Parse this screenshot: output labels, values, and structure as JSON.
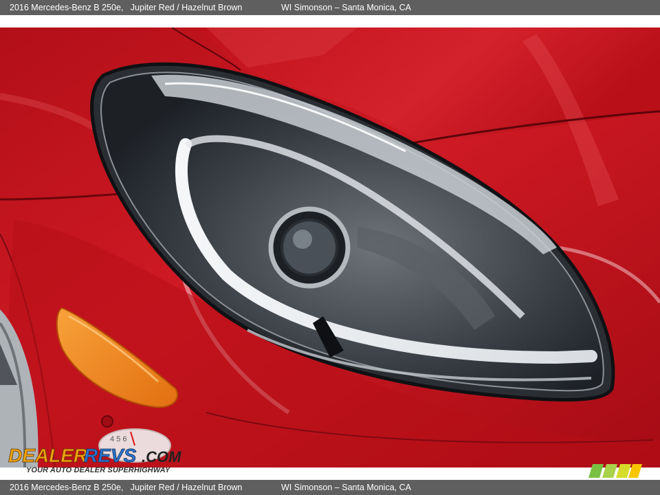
{
  "header": {
    "vehicle": "2016 Mercedes-Benz B 250e,   Jupiter Red / Hazelnut Brown",
    "dealer": "WI Simonson – Santa Monica, CA"
  },
  "footer": {
    "vehicle": "2016 Mercedes-Benz B 250e,   Jupiter Red / Hazelnut Brown",
    "dealer": "WI Simonson – Santa Monica, CA"
  },
  "photo": {
    "subject": "headlight-closeup",
    "paint_color": "#c8141f"
  },
  "watermark": {
    "brand": "DealerRevs.com",
    "tagline": "YOUR AUTO DEALER SUPERHIGHWAY"
  },
  "colors": {
    "bar": "#5f5f5f",
    "paint": "#c8141f",
    "marker_amber": "#f08a1c",
    "logo_green": "#7ac143",
    "logo_yellow": "#f7c600"
  }
}
